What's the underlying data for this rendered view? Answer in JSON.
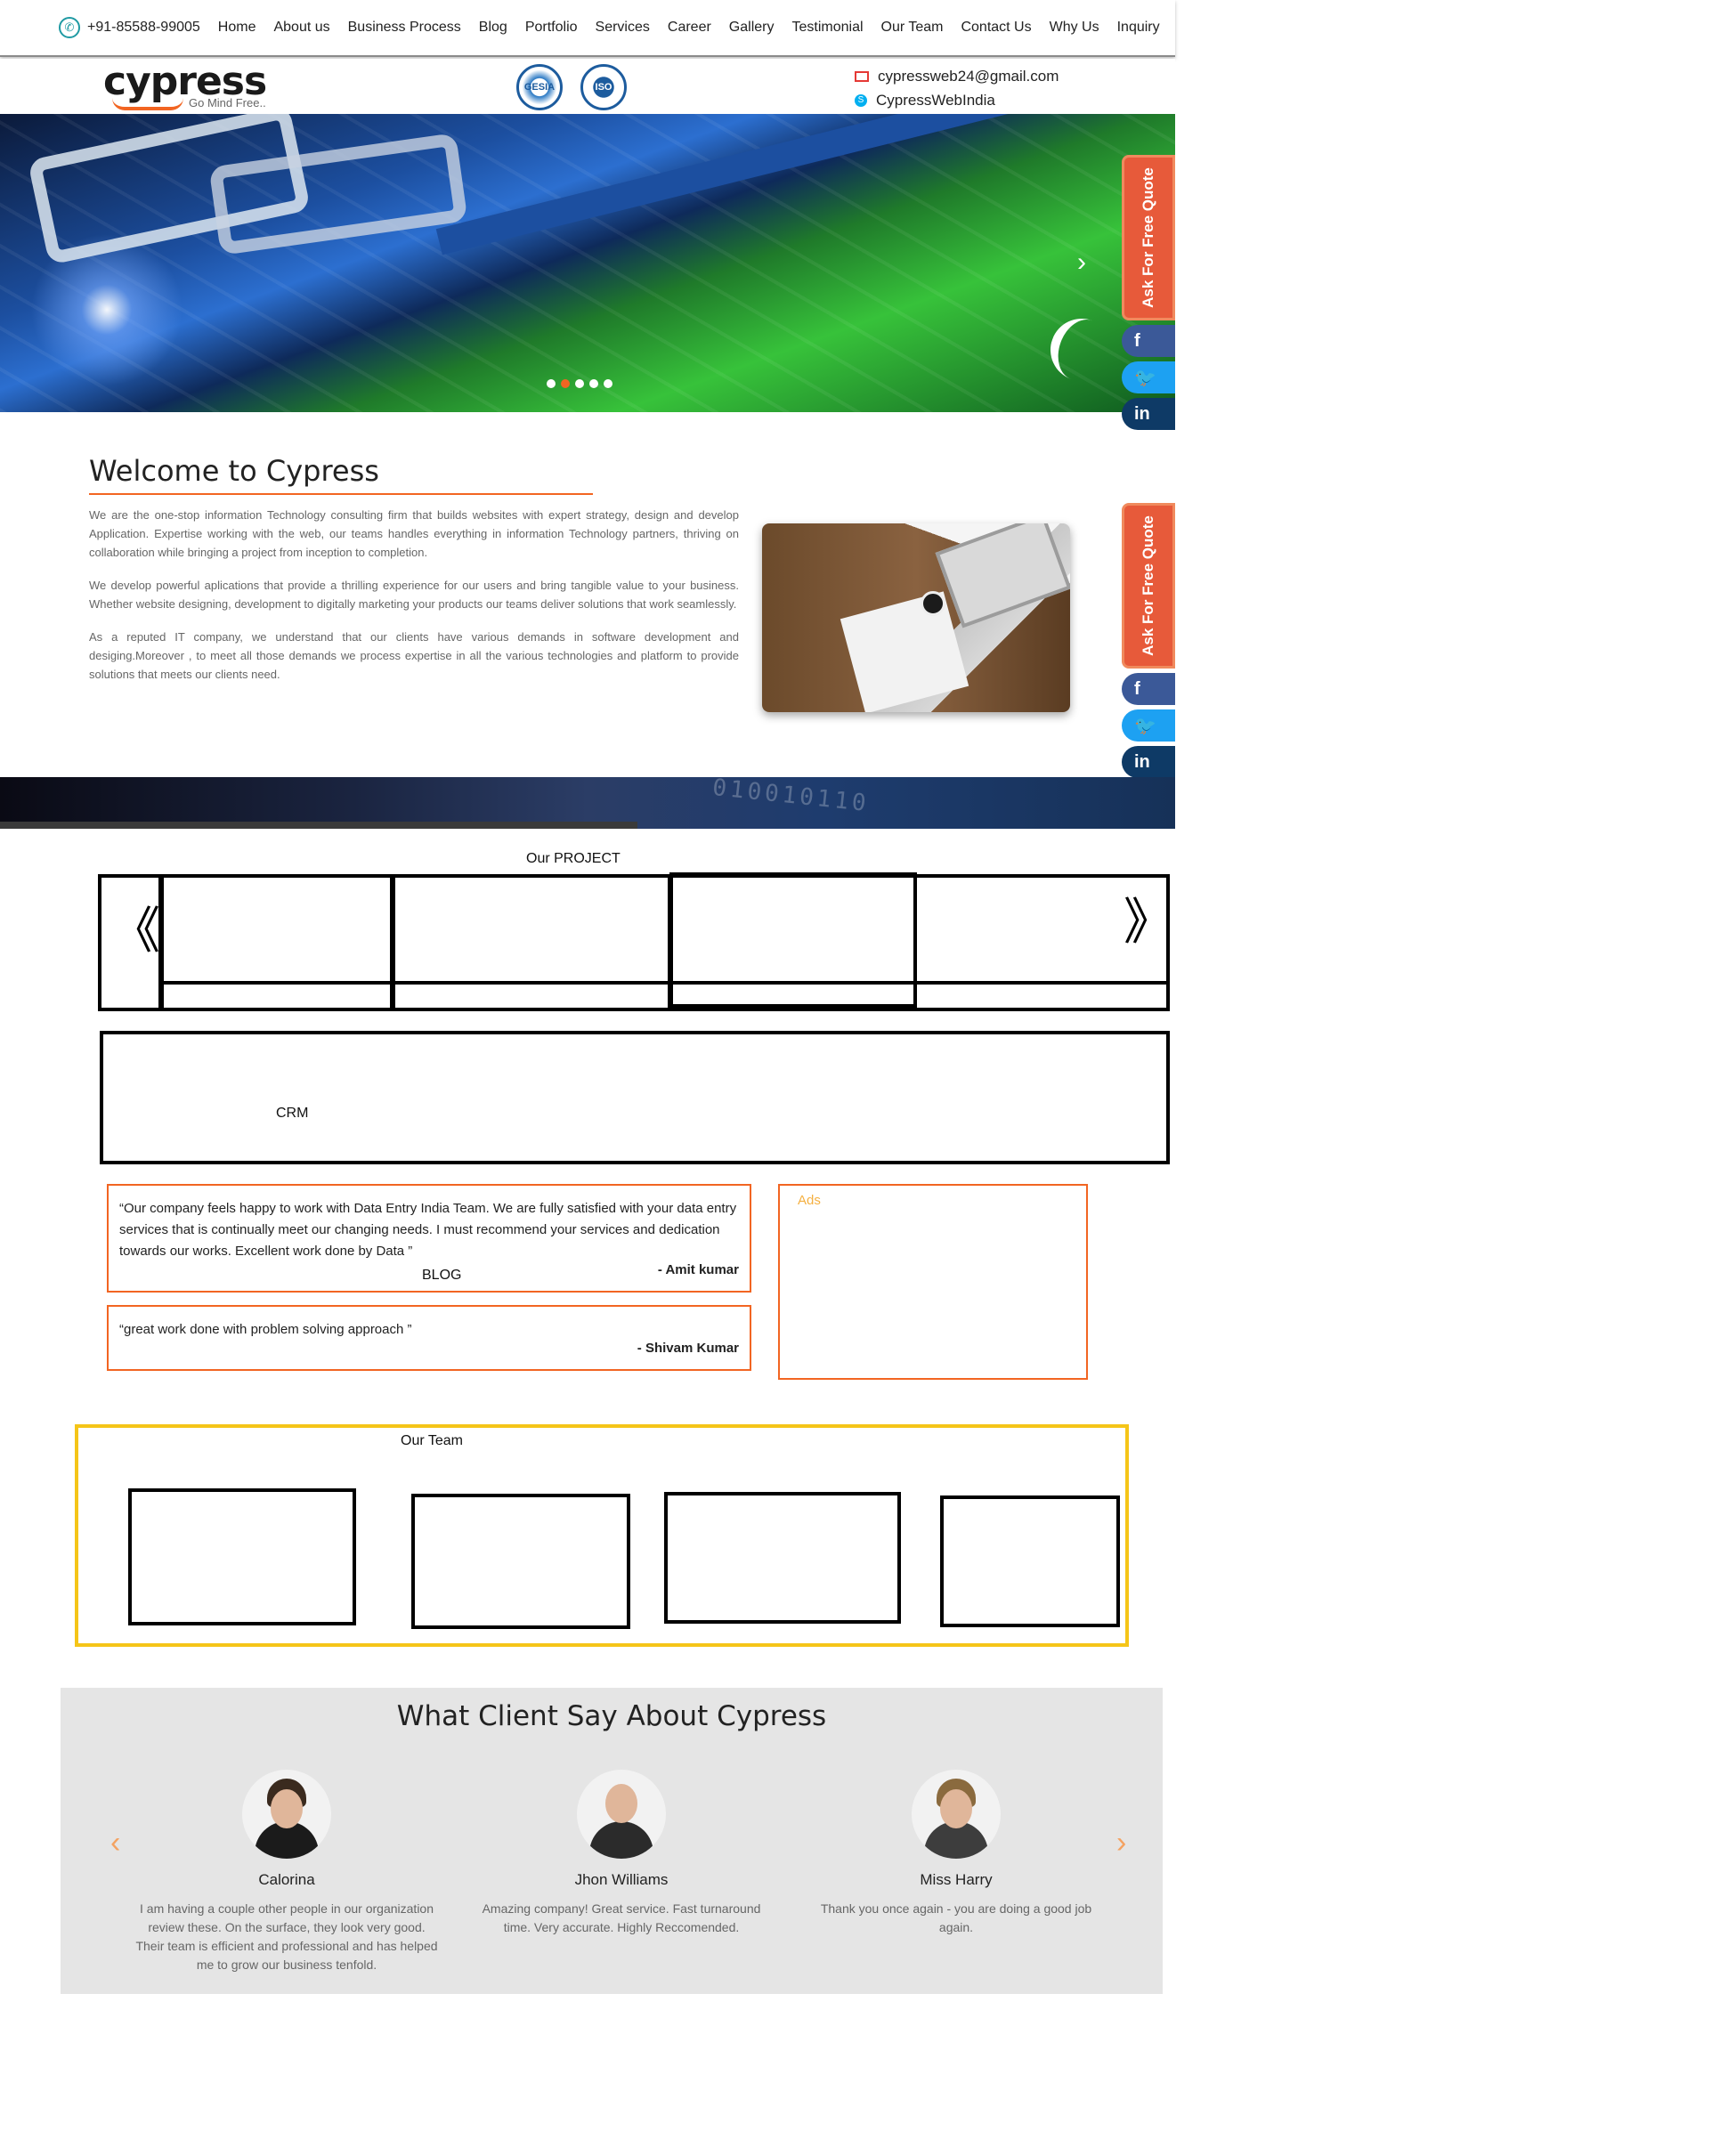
{
  "topbar": {
    "phone": "+91-85588-99005",
    "menu": [
      "Home",
      "About us",
      "Business Process",
      "Blog",
      "Portfolio",
      "Services",
      "Career",
      "Gallery",
      "Testimonial",
      "Our Team",
      "Contact Us",
      "Why Us",
      "Inquiry"
    ]
  },
  "logo": {
    "wordmark": "cypress",
    "tagline": "Go Mind Free.."
  },
  "badges": {
    "b1": "GESIA",
    "b2": "ISO"
  },
  "contact": {
    "email": "cypressweb24@gmail.com",
    "skype": "CypressWebIndia"
  },
  "hero": {
    "slides_total": 5,
    "active_slide": 2
  },
  "side_widget": {
    "quote_label": "Ask For Free Quote",
    "facebook": "f",
    "twitter": "t",
    "linkedin": "in"
  },
  "welcome": {
    "title": "Welcome to Cypress",
    "paragraphs": [
      "We are the one-stop information Technology consulting firm that builds websites with expert strategy, design and develop Application. Expertise working with the web, our teams handles everything in information Technology partners, thriving on collaboration while bringing a project from inception to completion.",
      "We develop powerful aplications that provide a thrilling experience for our users and bring tangible value to your business. Whether website designing, development to digitally marketing your products our teams deliver solutions that work seamlessly.",
      "As a reputed IT company, we understand that our clients have various demands in software development and desiging.Moreover , to meet all those demands we process expertise in all the various technologies and platform to provide solutions that meets our clients need."
    ]
  },
  "project": {
    "label": "Our PROJECT",
    "prev": "《",
    "next": "》"
  },
  "crm": {
    "label": "CRM"
  },
  "testimonials": [
    {
      "text": "“Our company feels happy to work with Data Entry India Team. We are fully satisfied with your data entry services that is continually meet our changing needs. I must recommend your services and dedication towards our works. Excellent work done by Data ”",
      "author": "- Amit kumar"
    },
    {
      "text": "“great work done with problem solving approach ”",
      "author": "- Shivam Kumar"
    }
  ],
  "blog": {
    "label": "BLOG"
  },
  "ads": {
    "label": "Ads"
  },
  "team": {
    "label": "Our Team"
  },
  "clients": {
    "title": "What Client Say About Cypress",
    "items": [
      {
        "name": "Calorina",
        "quote": "I am having a couple other people in our organization review these. On the surface, they look very good. Their team is efficient and professional and has helped me to grow our business tenfold."
      },
      {
        "name": "Jhon Williams",
        "quote": "Amazing company! Great service. Fast turnaround time. Very accurate. Highly Reccomended."
      },
      {
        "name": "Miss Harry",
        "quote": "Thank you once again - you are doing a good job again."
      }
    ],
    "prev": "‹",
    "next": "›"
  },
  "colors": {
    "accent": "#f26522",
    "team_frame": "#f5c518",
    "client_bg": "#e5e5e5",
    "quote_tab": "#e75a3a"
  }
}
